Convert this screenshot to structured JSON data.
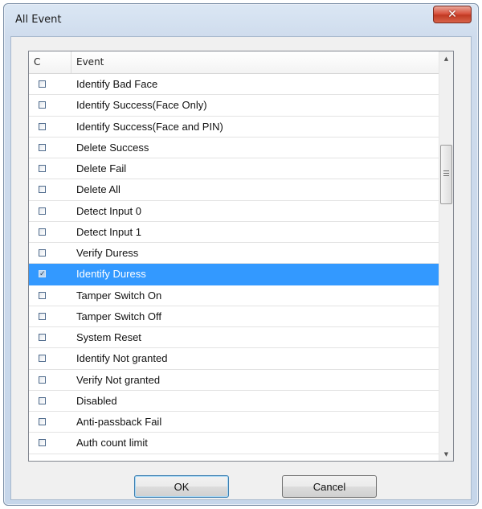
{
  "window": {
    "title": "All Event",
    "close_glyph": "✕"
  },
  "colors": {
    "selection": "#3399ff",
    "close_button": "#c13a23"
  },
  "table": {
    "headers": {
      "check": "C",
      "event": "Event"
    },
    "rows": [
      {
        "label": "Identify Bad Face",
        "checked": false,
        "selected": false
      },
      {
        "label": "Identify Success(Face Only)",
        "checked": false,
        "selected": false
      },
      {
        "label": "Identify Success(Face and PIN)",
        "checked": false,
        "selected": false
      },
      {
        "label": "Delete Success",
        "checked": false,
        "selected": false
      },
      {
        "label": "Delete Fail",
        "checked": false,
        "selected": false
      },
      {
        "label": "Delete All",
        "checked": false,
        "selected": false
      },
      {
        "label": "Detect Input 0",
        "checked": false,
        "selected": false
      },
      {
        "label": "Detect Input 1",
        "checked": false,
        "selected": false
      },
      {
        "label": "Verify Duress",
        "checked": false,
        "selected": false
      },
      {
        "label": "Identify Duress",
        "checked": true,
        "selected": true
      },
      {
        "label": "Tamper Switch On",
        "checked": false,
        "selected": false
      },
      {
        "label": "Tamper Switch Off",
        "checked": false,
        "selected": false
      },
      {
        "label": "System Reset",
        "checked": false,
        "selected": false
      },
      {
        "label": "Identify Not granted",
        "checked": false,
        "selected": false
      },
      {
        "label": "Verify Not granted",
        "checked": false,
        "selected": false
      },
      {
        "label": "Disabled",
        "checked": false,
        "selected": false
      },
      {
        "label": "Anti-passback Fail",
        "checked": false,
        "selected": false
      },
      {
        "label": "Auth count limit",
        "checked": false,
        "selected": false
      }
    ]
  },
  "buttons": {
    "ok": "OK",
    "cancel": "Cancel"
  },
  "icons": {
    "close": "close-icon",
    "scroll_up": "chevron-up-icon",
    "scroll_down": "chevron-down-icon",
    "check": "checkmark-icon"
  }
}
